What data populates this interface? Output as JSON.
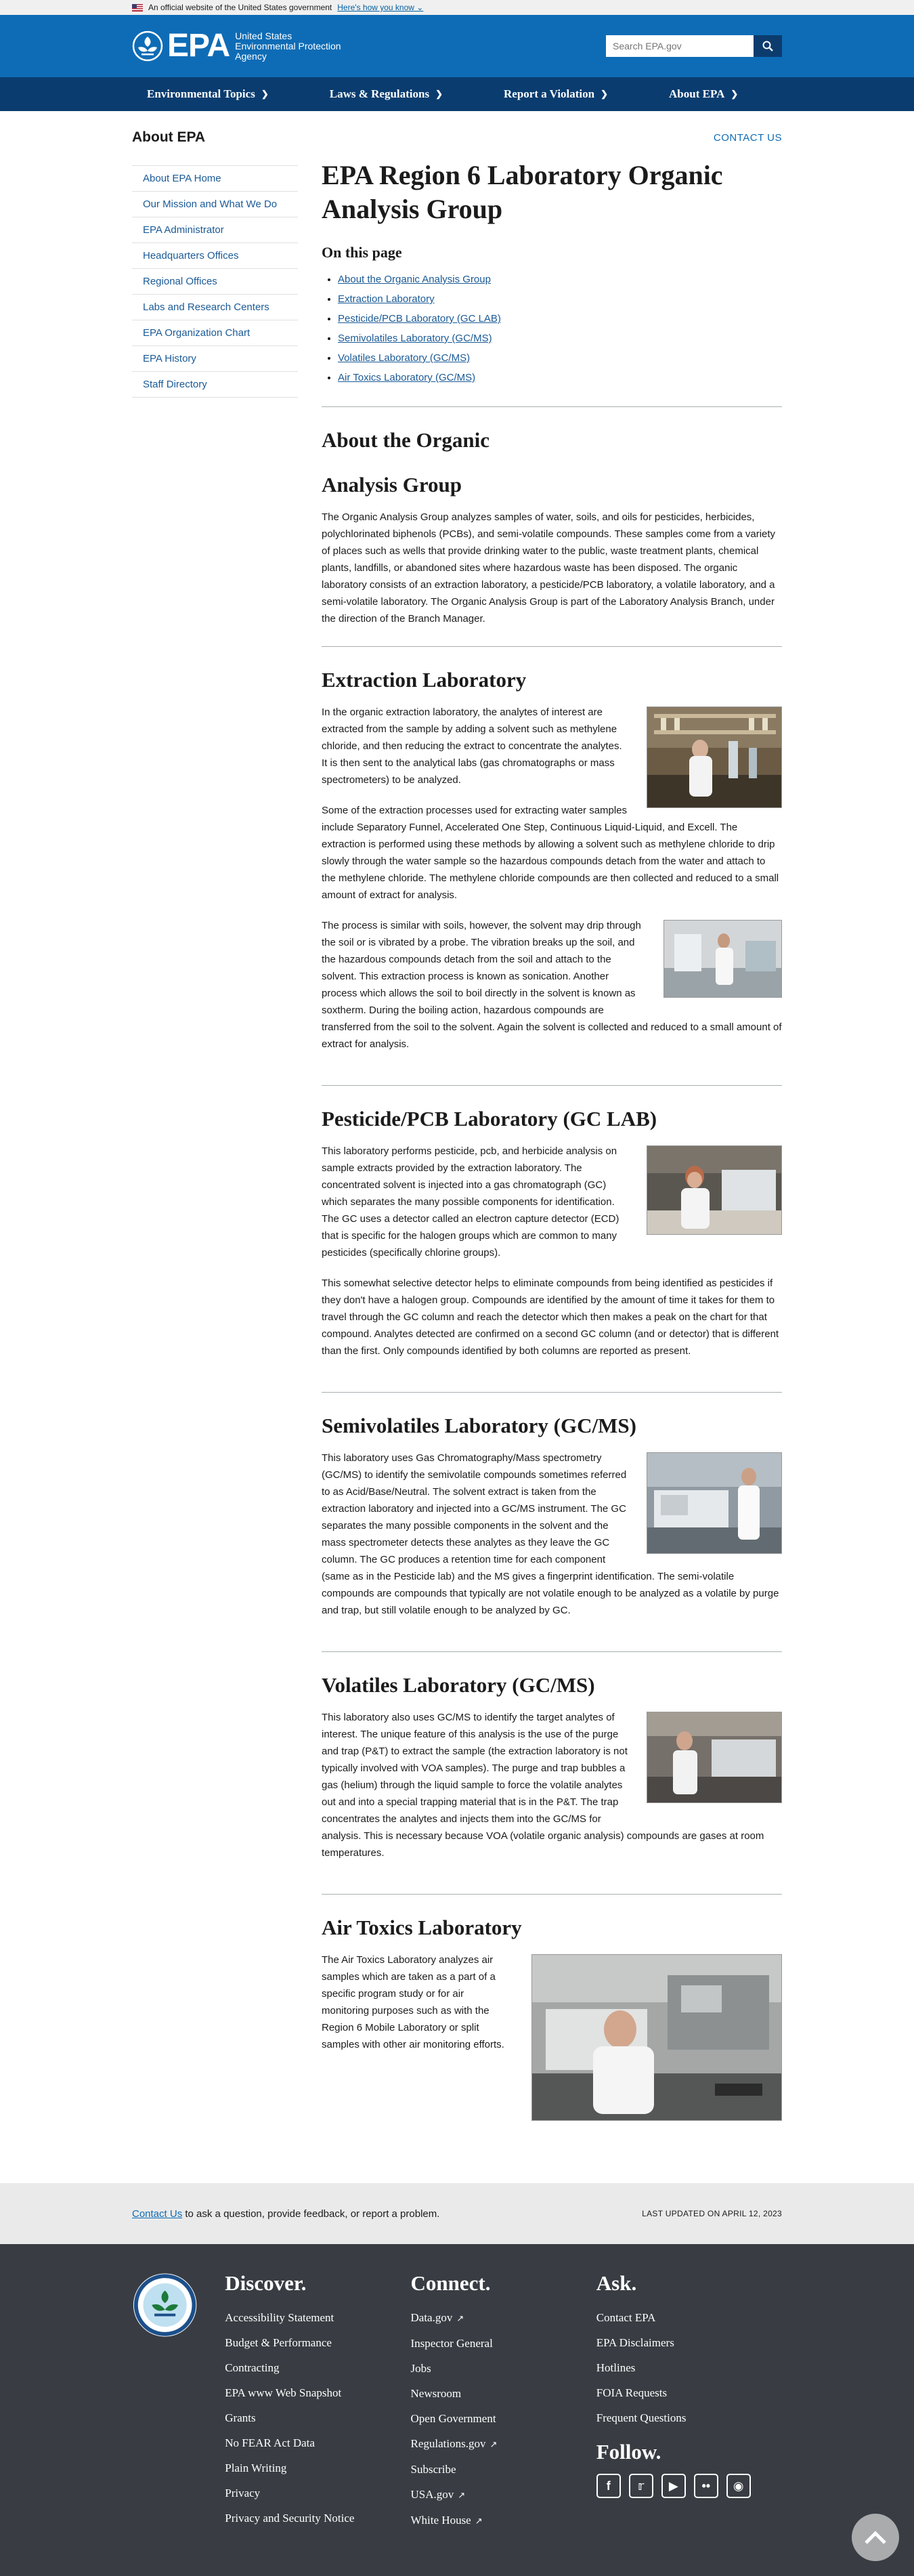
{
  "banner": {
    "text": "An official website of the United States government",
    "link": "Here's how you know"
  },
  "header": {
    "logo_word": "EPA",
    "agency_line1": "United States",
    "agency_line2": "Environmental Protection",
    "agency_line3": "Agency",
    "search_placeholder": "Search EPA.gov",
    "brand_color": "#0e6cb6"
  },
  "nav": {
    "items": [
      {
        "label": "Environmental Topics"
      },
      {
        "label": "Laws & Regulations"
      },
      {
        "label": "Report a Violation"
      },
      {
        "label": "About EPA"
      }
    ]
  },
  "section": {
    "title": "About EPA",
    "contact": "CONTACT US"
  },
  "sidebar": {
    "items": [
      {
        "label": "About EPA Home"
      },
      {
        "label": "Our Mission and What We Do"
      },
      {
        "label": "EPA Administrator"
      },
      {
        "label": "Headquarters Offices"
      },
      {
        "label": "Regional Offices"
      },
      {
        "label": "Labs and Research Centers"
      },
      {
        "label": "EPA Organization Chart"
      },
      {
        "label": "EPA History"
      },
      {
        "label": "Staff Directory"
      }
    ]
  },
  "main": {
    "title": "EPA Region 6 Laboratory Organic Analysis Group",
    "on_this_page": "On this page",
    "toc": [
      {
        "label": "About the Organic Analysis Group"
      },
      {
        "label": "Extraction Laboratory"
      },
      {
        "label": "Pesticide/PCB Laboratory (GC LAB)"
      },
      {
        "label": "Semivolatiles Laboratory (GC/MS)"
      },
      {
        "label": "Volatiles Laboratory (GC/MS)"
      },
      {
        "label": "Air Toxics Laboratory (GC/MS)"
      }
    ],
    "about": {
      "heading_line1": "About the Organic",
      "heading_line2": "Analysis Group",
      "p1": "The Organic Analysis Group analyzes samples of water, soils, and oils for pesticides, herbicides, polychlorinated biphenols (PCBs), and semi-volatile compounds. These samples come from a variety of places such as wells that provide drinking water to the public, waste treatment plants, chemical plants, landfills, or abandoned sites where hazardous waste has been disposed. The organic laboratory consists of an extraction laboratory, a pesticide/PCB laboratory, a volatile laboratory, and a semi-volatile laboratory. The Organic Analysis Group is part of the Laboratory Analysis Branch, under the direction of the Branch Manager."
    },
    "extraction": {
      "heading": "Extraction Laboratory",
      "p1": "In the organic extraction laboratory, the analytes of interest are extracted from the sample by adding a solvent such as methylene chloride, and then reducing the extract to concentrate the analytes. It is then sent to the analytical labs (gas chromatographs or mass spectrometers) to be analyzed.",
      "p2": "Some of the extraction processes used for extracting water samples include Separatory Funnel, Accelerated One Step, Continuous Liquid-Liquid, and Excell. The extraction is performed using these methods by allowing a solvent such as methylene chloride to drip slowly through the water sample so the hazardous compounds detach from the water and attach to the methylene chloride. The methylene chloride compounds are then collected and reduced to a small amount of extract for analysis.",
      "p3": "The process is similar with soils, however, the solvent may drip through the soil or is vibrated by a probe. The vibration breaks up the soil, and the hazardous compounds detach from the soil and attach to the solvent. This extraction process is known as sonication. Another process which allows the soil to boil directly in the solvent is known as soxtherm. During the boiling action, hazardous compounds are transferred from the soil to the solvent. Again the solvent is collected and reduced to a small amount of extract for analysis."
    },
    "pesticide": {
      "heading": "Pesticide/PCB Laboratory (GC LAB)",
      "p1": "This laboratory performs pesticide, pcb, and herbicide analysis on sample extracts provided by the extraction laboratory. The concentrated solvent is injected into a gas chromatograph (GC) which separates the many possible components for identification. The GC uses a detector called an electron capture detector (ECD) that is specific for the halogen groups which are common to many pesticides (specifically chlorine groups).",
      "p2": "This somewhat selective detector helps to eliminate compounds from being identified as pesticides if they don't have a halogen group. Compounds are identified by the amount of time it takes for them to travel through the GC column and reach the detector which then makes a peak on the chart for that compound. Analytes detected are confirmed on a second GC column (and or detector) that is different than the first. Only compounds identified by both columns are reported as present."
    },
    "semivolatiles": {
      "heading": "Semivolatiles Laboratory (GC/MS)",
      "p1": "This laboratory uses Gas Chromatography/Mass spectrometry (GC/MS) to identify the semivolatile compounds sometimes referred to as Acid/Base/Neutral. The solvent extract is taken from the extraction laboratory and injected into a GC/MS instrument. The GC separates the many possible components in the solvent and the mass spectrometer detects these analytes as they leave the GC column. The GC produces a retention time for each component (same as in the Pesticide lab) and the MS gives a fingerprint identification. The semi-volatile compounds are compounds that typically are not volatile enough to be analyzed as a volatile by purge and trap, but still volatile enough to be analyzed by GC."
    },
    "volatiles": {
      "heading": "Volatiles Laboratory (GC/MS)",
      "p1": "This laboratory also uses GC/MS to identify the target analytes of interest. The unique feature of this analysis is the use of the purge and trap (P&T) to extract the sample (the extraction laboratory is not typically involved with VOA samples). The purge and trap bubbles a gas (helium) through the liquid sample to force the volatile analytes out and into a special trapping material that is in the P&T. The trap concentrates the analytes and injects them into the GC/MS for analysis. This is necessary because VOA (volatile organic analysis) compounds are gases at room temperatures."
    },
    "airtoxics": {
      "heading": "Air Toxics Laboratory",
      "p1": "The Air Toxics Laboratory analyzes air samples which are taken as a part of a specific program study or for air monitoring purposes such as with the Region 6 Mobile Laboratory or split samples with other air monitoring efforts."
    }
  },
  "footer_top": {
    "contact_link": "Contact Us",
    "contact_text": " to ask a question, provide feedback, or report a problem.",
    "last_updated": "LAST UPDATED ON APRIL 12, 2023"
  },
  "footer": {
    "discover": {
      "heading": "Discover.",
      "links": [
        "Accessibility Statement",
        "Budget & Performance",
        "Contracting",
        "EPA www Web Snapshot",
        "Grants",
        "No FEAR Act Data",
        "Plain Writing",
        "Privacy",
        "Privacy and Security Notice"
      ]
    },
    "connect": {
      "heading": "Connect.",
      "links": [
        "Data.gov",
        "Inspector General",
        "Jobs",
        "Newsroom",
        "Open Government",
        "Regulations.gov",
        "Subscribe",
        "USA.gov",
        "White House"
      ]
    },
    "ask": {
      "heading": "Ask.",
      "links": [
        "Contact EPA",
        "EPA Disclaimers",
        "Hotlines",
        "FOIA Requests",
        "Frequent Questions"
      ]
    },
    "follow_heading": "Follow.",
    "social_icons": [
      "facebook-icon",
      "twitter-icon",
      "youtube-icon",
      "flickr-icon",
      "instagram-icon"
    ]
  }
}
